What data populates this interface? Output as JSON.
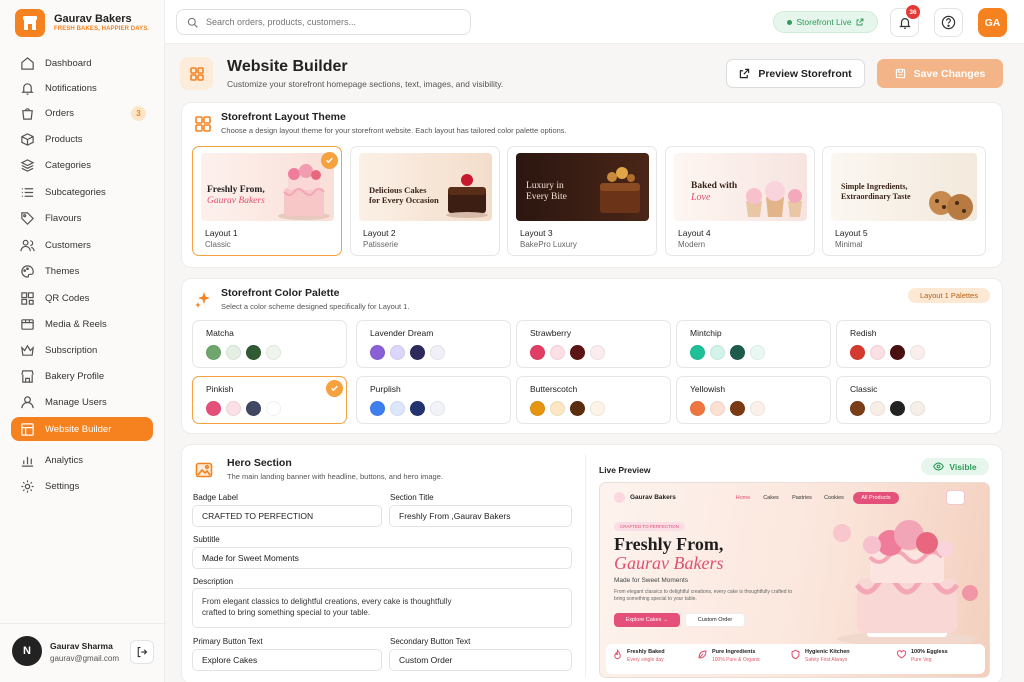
{
  "brand": {
    "name": "Gaurav Bakers",
    "tagline": "FRESH BAKES, HAPPIER DAYS."
  },
  "sidebar": {
    "items": [
      {
        "label": "Dashboard",
        "icon": "home-icon"
      },
      {
        "label": "Notifications",
        "icon": "bell-icon"
      },
      {
        "label": "Orders",
        "icon": "bag-icon",
        "badge": "3"
      },
      {
        "label": "Products",
        "icon": "box-icon"
      },
      {
        "label": "Categories",
        "icon": "layers-icon"
      },
      {
        "label": "Subcategories",
        "icon": "list-icon"
      },
      {
        "label": "Flavours",
        "icon": "tag-icon"
      },
      {
        "label": "Customers",
        "icon": "users-icon"
      },
      {
        "label": "Themes",
        "icon": "palette-icon"
      },
      {
        "label": "QR Codes",
        "icon": "qr-icon"
      },
      {
        "label": "Media & Reels",
        "icon": "media-icon"
      },
      {
        "label": "Subscription",
        "icon": "crown-icon"
      },
      {
        "label": "Bakery Profile",
        "icon": "store-icon"
      },
      {
        "label": "Manage Users",
        "icon": "user-icon"
      },
      {
        "label": "Website Builder",
        "icon": "layout-icon",
        "active": true
      },
      {
        "label": "Analytics",
        "icon": "chart-icon"
      },
      {
        "label": "Settings",
        "icon": "gear-icon"
      }
    ],
    "user": {
      "initial": "N",
      "name": "Gaurav Sharma",
      "email": "gaurav@gmail.com"
    }
  },
  "topbar": {
    "search_placeholder": "Search orders, products, customers...",
    "storefront_status": "Storefront Live",
    "notification_count": "36",
    "avatar_initials": "GA"
  },
  "header": {
    "title": "Website Builder",
    "subtitle": "Customize your storefront homepage sections, text, images, and visibility.",
    "preview_button": "Preview Storefront",
    "save_button": "Save Changes"
  },
  "layout_theme": {
    "title": "Storefront Layout Theme",
    "subtitle": "Choose a design layout theme for your storefront website. Each layout has tailored color palette options.",
    "layouts": [
      {
        "name": "Layout 1",
        "style": "Classic",
        "thumb_lines": [
          "Freshly From,",
          "Gaurav Bakers"
        ],
        "selected": true
      },
      {
        "name": "Layout 2",
        "style": "Patisserie",
        "thumb_lines": [
          "Delicious Cakes",
          "for Every Occasion"
        ]
      },
      {
        "name": "Layout 3",
        "style": "BakePro Luxury",
        "thumb_lines": [
          "Luxury in",
          "Every Bite"
        ]
      },
      {
        "name": "Layout 4",
        "style": "Modern",
        "thumb_lines": [
          "Baked with",
          "Love"
        ]
      },
      {
        "name": "Layout 5",
        "style": "Minimal",
        "thumb_lines": [
          "Simple Ingredients,",
          "Extraordinary Taste"
        ]
      }
    ]
  },
  "color_palette": {
    "title": "Storefront Color Palette",
    "subtitle": "Select a color scheme designed specifically for Layout 1.",
    "tag": "Layout 1 Palettes",
    "palettes": [
      {
        "name": "Matcha",
        "colors": [
          "#6fa66d",
          "#e4efe3",
          "#2f5a33",
          "#eef5ec"
        ]
      },
      {
        "name": "Lavender Dream",
        "colors": [
          "#8b5fd6",
          "#ddd6fb",
          "#2d2a5c",
          "#f1eff7"
        ]
      },
      {
        "name": "Strawberry",
        "colors": [
          "#e23d64",
          "#fbdfe5",
          "#5b1515",
          "#fbecee"
        ]
      },
      {
        "name": "Mintchip",
        "colors": [
          "#1fbf98",
          "#d2f3ea",
          "#1d5c4d",
          "#eaf8f4"
        ]
      },
      {
        "name": "Redish",
        "colors": [
          "#d63a2f",
          "#fbdfe2",
          "#4a0f0f",
          "#faefed"
        ]
      },
      {
        "name": "Pinkish",
        "colors": [
          "#e5507a",
          "#fadfe6",
          "#3f4762",
          "#ffffff"
        ],
        "selected": true
      },
      {
        "name": "Purplish",
        "colors": [
          "#3d7ff0",
          "#dde6fb",
          "#23336e",
          "#f1f3f8"
        ]
      },
      {
        "name": "Butterscotch",
        "colors": [
          "#e5950f",
          "#fbe7c4",
          "#5a2d0e",
          "#fdf3e7"
        ]
      },
      {
        "name": "Yellowish",
        "colors": [
          "#f07640",
          "#fbe1d4",
          "#7a3a14",
          "#fbf1ea"
        ]
      },
      {
        "name": "Classic",
        "colors": [
          "#7a3e19",
          "#f7eee5",
          "#222222",
          "#f5efe7"
        ]
      }
    ]
  },
  "hero": {
    "title": "Hero Section",
    "subtitle": "The main landing banner with headline, buttons, and hero image.",
    "fields": {
      "badge_label": {
        "label": "Badge Label",
        "value": "CRAFTED TO PERFECTION"
      },
      "section_title": {
        "label": "Section Title",
        "value": "Freshly From ,Gaurav Bakers"
      },
      "subtitle": {
        "label": "Subtitle",
        "value": "Made for Sweet Moments"
      },
      "description": {
        "label": "Description",
        "value": "From elegant classics to delightful creations, every cake is thoughtfully crafted to bring something special to your table."
      },
      "primary_button": {
        "label": "Primary Button Text",
        "value": "Explore Cakes"
      },
      "secondary_button": {
        "label": "Secondary Button Text",
        "value": "Custom Order"
      }
    }
  },
  "live_preview": {
    "label": "Live Preview",
    "visibility": "Visible",
    "brand": "Gaurav Bakers",
    "nav": [
      "Home",
      "Cakes",
      "Pastries",
      "Cookies",
      "All Products"
    ],
    "badge": "CRAFTED TO PERFECTION",
    "headline": "Freshly From,",
    "headline_script": "Gaurav Bakers",
    "subline": "Made for Sweet Moments",
    "description": "From elegant classics to delightful creations, every cake is thoughtfully crafted to bring something special to your table.",
    "primary_btn": "Explore Cakes →",
    "secondary_btn": "Custom Order",
    "features": [
      {
        "title": "Freshly Baked",
        "sub": "Every single day"
      },
      {
        "title": "Pure Ingredients",
        "sub": "100% Pure & Organic"
      },
      {
        "title": "Hygienic Kitchen",
        "sub": "Safety First Always"
      },
      {
        "title": "100% Eggless",
        "sub": "Pure Veg"
      }
    ]
  },
  "colors": {
    "accent": "#f5821f",
    "save_disabled": "#f3b587",
    "success": "#2e9c5a",
    "pink": "#e5507a"
  }
}
